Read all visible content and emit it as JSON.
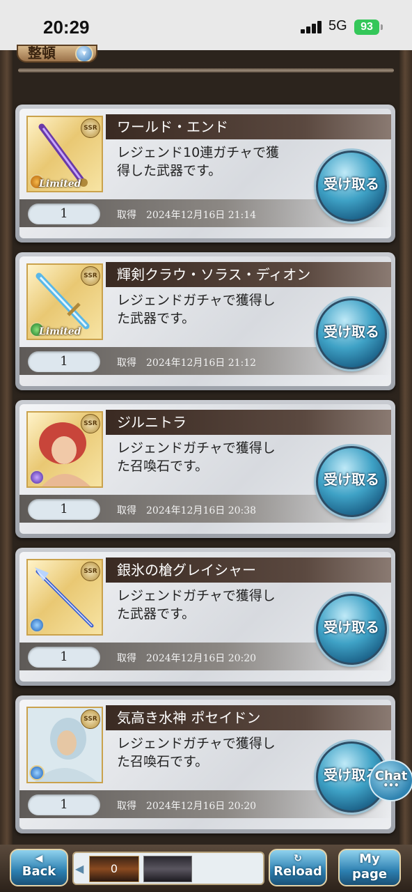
{
  "status_bar": {
    "time": "20:29",
    "network": "5G",
    "battery": "93"
  },
  "header": {
    "tab_label": "整頓",
    "tab_icon": "chevron-down-icon"
  },
  "cards": [
    {
      "name": "ワールド・エンド",
      "desc_line1": "レジェンド10連ガチャで獲",
      "desc_line2": "得した武器です。",
      "quantity": "1",
      "acquired_label": "取得",
      "date": "2024年12月16日 21:14",
      "rarity": "SSR",
      "badge": "Limited",
      "button": "受け取る",
      "element_color": "#c8860a"
    },
    {
      "name": "輝剣クラウ・ソラス・ディオン",
      "desc_line1": "レジェンドガチャで獲得し",
      "desc_line2": "た武器です。",
      "quantity": "1",
      "acquired_label": "取得",
      "date": "2024年12月16日 21:12",
      "rarity": "SSR",
      "badge": "Limited",
      "button": "受け取る",
      "element_color": "#2e9a3a"
    },
    {
      "name": "ジルニトラ",
      "desc_line1": "レジェンドガチャで獲得し",
      "desc_line2": "た召喚石です。",
      "quantity": "1",
      "acquired_label": "取得",
      "date": "2024年12月16日 20:38",
      "rarity": "SSR",
      "badge": "",
      "button": "受け取る",
      "element_color": "#6a44c8"
    },
    {
      "name": "銀氷の槍グレイシャー",
      "desc_line1": "レジェンドガチャで獲得し",
      "desc_line2": "た武器です。",
      "quantity": "1",
      "acquired_label": "取得",
      "date": "2024年12月16日 20:20",
      "rarity": "SSR",
      "badge": "",
      "button": "受け取る",
      "element_color": "#2a7ad8"
    },
    {
      "name": "気高き水神 ポセイドン",
      "desc_line1": "レジェンドガチャで獲得し",
      "desc_line2": "た召喚石です。",
      "quantity": "1",
      "acquired_label": "取得",
      "date": "2024年12月16日 20:20",
      "rarity": "SSR",
      "badge": "",
      "button": "受け取る",
      "element_color": "#2a7ad8"
    }
  ],
  "chat": {
    "label": "Chat",
    "dots": "•••"
  },
  "bottom_nav": {
    "back": "Back",
    "reload": "Reload",
    "mypage_line1": "My",
    "mypage_line2": "page",
    "strip_count": "0"
  }
}
